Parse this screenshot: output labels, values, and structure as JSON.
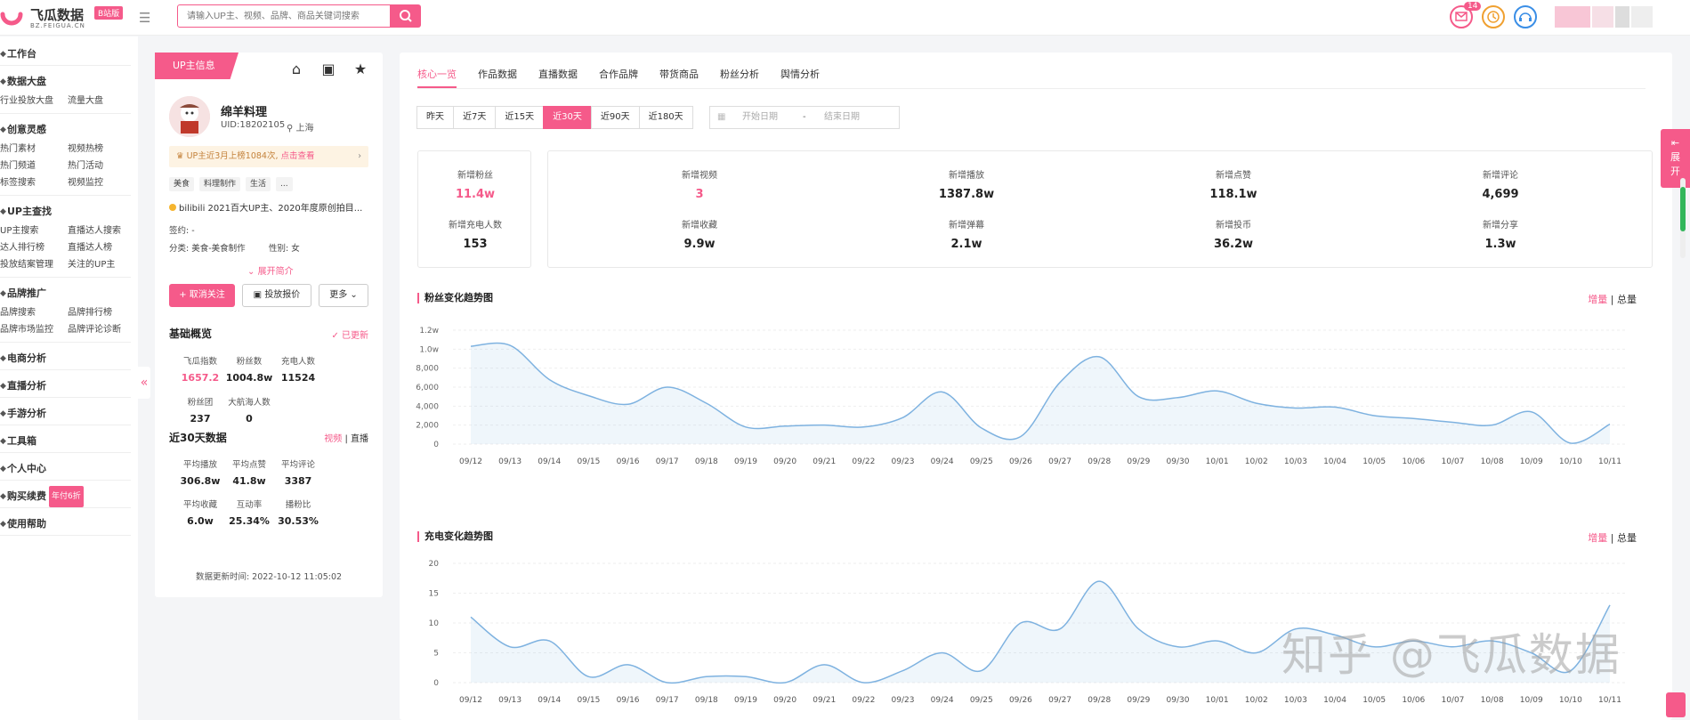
{
  "app": {
    "title": "飞瓜数据",
    "badge": "B站版",
    "domain": "BZ.FEIGUA.CN"
  },
  "search": {
    "placeholder": "请输入UP主、视频、品牌、商品关键词搜索"
  },
  "header": {
    "msg_count": "14"
  },
  "sidebar": {
    "groups": [
      {
        "title": "工作台",
        "items": []
      },
      {
        "title": "数据大盘",
        "items": [
          "行业投放大盘",
          "流量大盘"
        ]
      },
      {
        "title": "创意灵感",
        "items": [
          "热门素材",
          "视频热榜",
          "热门频道",
          "热门活动",
          "标签搜索",
          "视频监控"
        ]
      },
      {
        "title": "UP主查找",
        "items": [
          "UP主搜索",
          "直播达人搜索",
          "达人排行榜",
          "直播达人榜",
          "投放结案管理",
          "关注的UP主"
        ]
      },
      {
        "title": "品牌推广",
        "items": [
          "品牌搜索",
          "品牌排行榜",
          "品牌市场监控",
          "品牌评论诊断"
        ]
      },
      {
        "title": "电商分析",
        "items": []
      },
      {
        "title": "直播分析",
        "items": []
      },
      {
        "title": "手游分析",
        "items": []
      },
      {
        "title": "工具箱",
        "items": []
      },
      {
        "title": "个人中心",
        "items": []
      },
      {
        "title": "购买续费",
        "badge": "年付6折",
        "items": []
      },
      {
        "title": "使用帮助",
        "items": []
      }
    ]
  },
  "profile": {
    "tag": "UP主信息",
    "name": "绵羊料理",
    "uid": "UID:18202105",
    "location": "上海",
    "notice": "UP主近3月上榜1084次, ",
    "notice_link": "点击查看",
    "tags": [
      "美食",
      "料理制作",
      "生活",
      "..."
    ],
    "desc": "bilibili 2021百大UP主、2020年度原创拍目...",
    "sign_label": "签约:",
    "sign_value": "-",
    "category_label": "分类:",
    "category_value": "美食-美食制作",
    "gender_label": "性别:",
    "gender_value": "女",
    "expand": "展开简介",
    "btn_follow": "+ 取消关注",
    "btn_price": "投放报价",
    "btn_more": "更多",
    "overview_title": "基础概览",
    "updated": "✓ 已更新",
    "overview": [
      {
        "label": "飞瓜指数",
        "value": "1657.2"
      },
      {
        "label": "粉丝数",
        "value": "1004.8w"
      },
      {
        "label": "充电人数",
        "value": "11524"
      },
      {
        "label": "粉丝团",
        "value": "237"
      },
      {
        "label": "大航海人数",
        "value": "0"
      }
    ],
    "recent_title": "近30天数据",
    "recent_video": "视频",
    "recent_live": "直播",
    "recent": [
      {
        "label": "平均播放",
        "value": "306.8w"
      },
      {
        "label": "平均点赞",
        "value": "41.8w"
      },
      {
        "label": "平均评论",
        "value": "3387"
      },
      {
        "label": "平均收藏",
        "value": "6.0w"
      },
      {
        "label": "互动率",
        "value": "25.34%"
      },
      {
        "label": "播粉比",
        "value": "30.53%"
      }
    ],
    "update_time": "数据更新时间: 2022-10-12 11:05:02"
  },
  "main": {
    "tabs": [
      "核心一览",
      "作品数据",
      "直播数据",
      "合作品牌",
      "带货商品",
      "粉丝分析",
      "舆情分析"
    ],
    "ranges": [
      "昨天",
      "近7天",
      "近15天",
      "近30天",
      "近90天",
      "近180天"
    ],
    "date_start": "开始日期",
    "date_sep": "-",
    "date_end": "结束日期",
    "stats_left": [
      {
        "label": "新增粉丝",
        "value": "11.4w"
      },
      {
        "label": "新增充电人数",
        "value": "153"
      }
    ],
    "stats_right": [
      {
        "label": "新增视频",
        "value": "3"
      },
      {
        "label": "新增播放",
        "value": "1387.8w"
      },
      {
        "label": "新增点赞",
        "value": "118.1w"
      },
      {
        "label": "新增评论",
        "value": "4,699"
      },
      {
        "label": "新增收藏",
        "value": "9.9w"
      },
      {
        "label": "新增弹幕",
        "value": "2.1w"
      },
      {
        "label": "新增投币",
        "value": "36.2w"
      },
      {
        "label": "新增分享",
        "value": "1.3w"
      }
    ],
    "toggle_inc": "增量",
    "toggle_total": "总量"
  },
  "chart_data": [
    {
      "type": "area",
      "title": "粉丝变化趋势图",
      "x": [
        "09/12",
        "09/13",
        "09/14",
        "09/15",
        "09/16",
        "09/17",
        "09/18",
        "09/19",
        "09/20",
        "09/21",
        "09/22",
        "09/23",
        "09/24",
        "09/25",
        "09/26",
        "09/27",
        "09/28",
        "09/29",
        "09/30",
        "10/01",
        "10/02",
        "10/03",
        "10/04",
        "10/05",
        "10/06",
        "10/07",
        "10/08",
        "10/09",
        "10/10",
        "10/11"
      ],
      "y_ticks": [
        "0",
        "2,000",
        "4,000",
        "6,000",
        "8,000",
        "1.0w",
        "1.2w"
      ],
      "ylim": [
        0,
        12000
      ],
      "values": [
        10300,
        10400,
        6800,
        5100,
        4200,
        6000,
        4300,
        1800,
        1900,
        2000,
        1800,
        2800,
        5500,
        1700,
        800,
        6500,
        9200,
        5000,
        4900,
        5600,
        4300,
        3800,
        3900,
        3000,
        2700,
        2300,
        2000,
        3400,
        100,
        2100
      ],
      "color": "#7eb2e0"
    },
    {
      "type": "area",
      "title": "充电变化趋势图",
      "x": [
        "09/12",
        "09/13",
        "09/14",
        "09/15",
        "09/16",
        "09/17",
        "09/18",
        "09/19",
        "09/20",
        "09/21",
        "09/22",
        "09/23",
        "09/24",
        "09/25",
        "09/26",
        "09/27",
        "09/28",
        "09/29",
        "09/30",
        "10/01",
        "10/02",
        "10/03",
        "10/04",
        "10/05",
        "10/06",
        "10/07",
        "10/08",
        "10/09",
        "10/10",
        "10/11"
      ],
      "y_ticks": [
        "0",
        "5",
        "10",
        "15",
        "20"
      ],
      "ylim": [
        0,
        20
      ],
      "values": [
        11,
        6,
        7,
        1,
        3,
        0,
        1,
        1,
        0,
        3,
        0,
        2,
        5,
        2,
        10,
        9,
        17,
        9,
        6,
        7,
        5,
        9,
        8,
        6,
        7,
        6,
        7,
        5,
        2,
        13
      ],
      "color": "#7eb2e0"
    }
  ],
  "watermark": "知乎 @飞瓜数据",
  "side_expand": "展开"
}
